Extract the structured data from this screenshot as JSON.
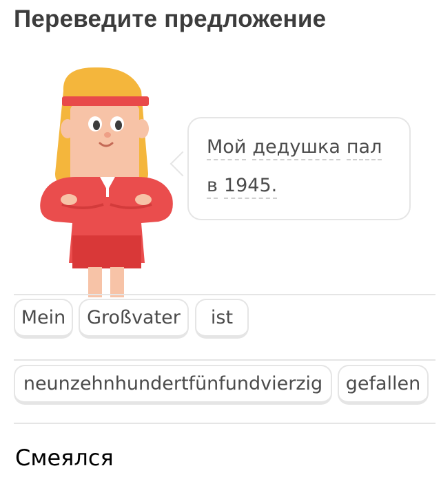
{
  "header": {
    "title": "Переведите предложение"
  },
  "prompt": {
    "line1_words": [
      "Мой",
      "дедушка",
      "пал"
    ],
    "line2_words": [
      "в",
      "1945."
    ]
  },
  "answer_tiles": [
    "Mein",
    "Großvater",
    "ist",
    "neunzehnhundertfünfundvierzig",
    "gefallen"
  ],
  "typed_text": "Смеялся",
  "colors": {
    "title": "#3c3c3c",
    "tile_border": "#e5e5e5",
    "character_shirt": "#ea4d4d",
    "character_hair": "#f4b63c",
    "headband": "#e84a4a"
  }
}
